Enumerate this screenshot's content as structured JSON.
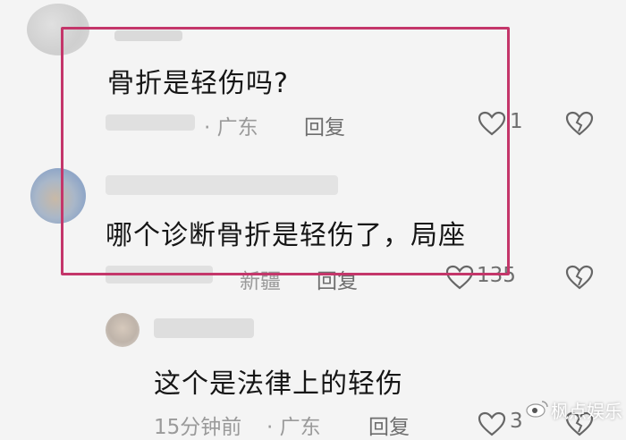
{
  "comments": [
    {
      "text": "骨折是轻伤吗?",
      "location": "广东",
      "reply_label": "回复",
      "like_count": "1"
    },
    {
      "text": "哪个诊断骨折是轻伤了，局座",
      "location": "新疆",
      "reply_label": "回复",
      "like_count": "135"
    },
    {
      "text": "这个是法律上的轻伤",
      "time": "15分钟前",
      "location": "广东",
      "reply_label": "回复",
      "like_count": "3"
    }
  ],
  "colors": {
    "highlight_border": "#c4366a",
    "background": "#f4f4f4"
  },
  "icons": [
    "heart-icon",
    "broken-heart-icon",
    "weibo-logo-icon"
  ],
  "watermark": "枫点娱乐"
}
